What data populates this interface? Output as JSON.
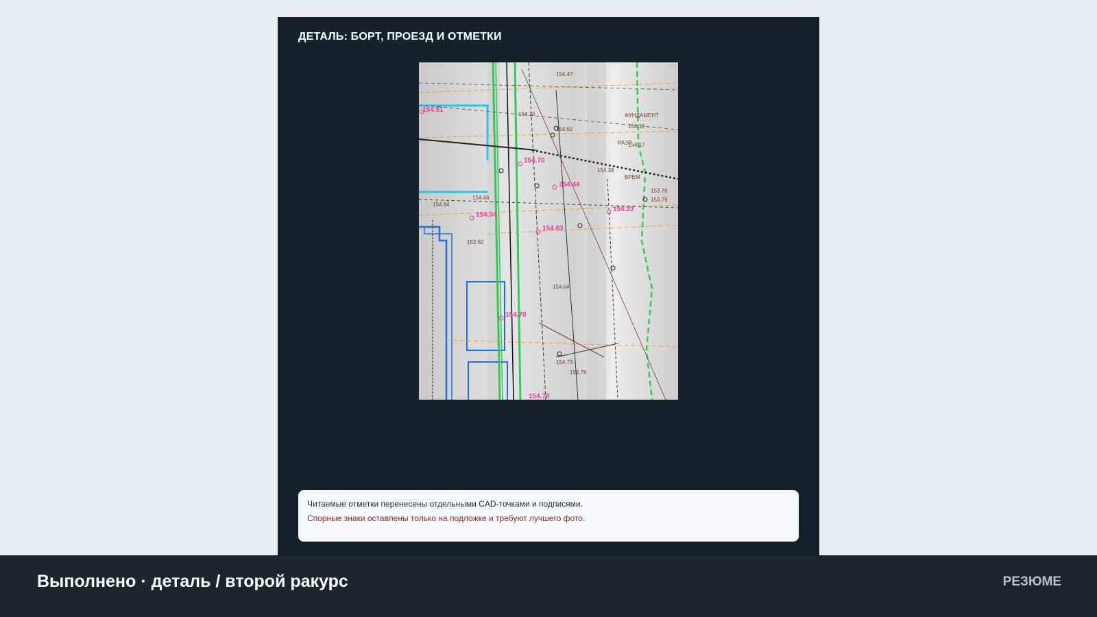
{
  "panel": {
    "title": "ДЕТАЛЬ: БОРТ, ПРОЕЗД И ОТМЕТКИ",
    "photo_labels": {
      "elevations": [
        "154.51",
        "154.70",
        "154.44",
        "154.23",
        "154.94",
        "154.63",
        "154.70",
        "154.78"
      ],
      "raster_text": [
        "154.47",
        "154.52",
        "154.70",
        "154.38",
        "154.15",
        "154.17",
        "153.78",
        "153.79",
        "154.94",
        "153.82",
        "154.66",
        "154.73",
        "154.78",
        "154.64",
        "РАЗР",
        "ФУНДАМЕНТ",
        "ВРЕМ"
      ]
    },
    "notes": {
      "line1": "Читаемые отметки перенесены отдельными CAD-точками и подписями.",
      "line2": "Спорные знаки оставлены только на подложке и требуют лучшего фото."
    }
  },
  "footer": {
    "title": "Выполнено · деталь / второй ракурс",
    "link": "РЕЗЮМЕ"
  },
  "colors": {
    "panel_bg": "#17212c",
    "page_bg": "#e8ecf1",
    "footer_bg": "#1f242d",
    "note_error": "#8b2b22",
    "elevation_label": "#e6399b",
    "cyan_line": "#2ec4e0",
    "green_line": "#34c759",
    "orange_dash": "#e8a33a"
  }
}
